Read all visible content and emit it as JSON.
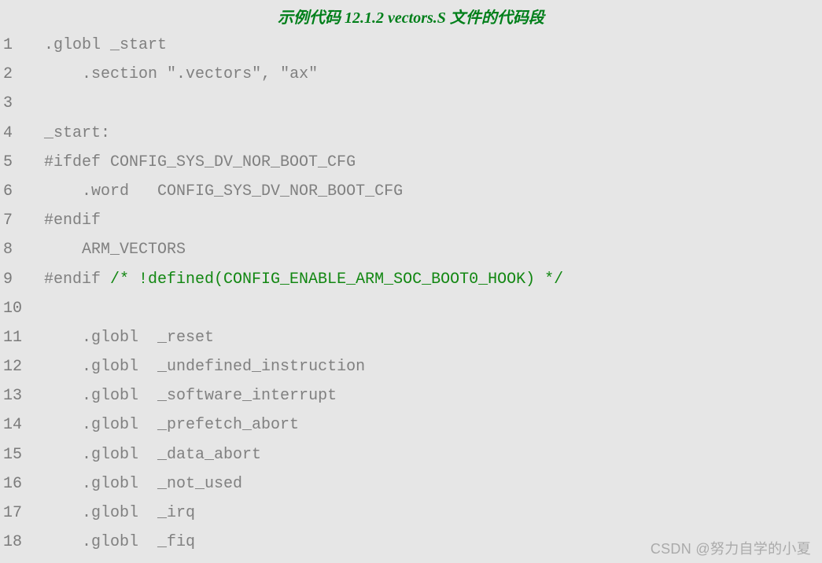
{
  "title": "示例代码 12.1.2 vectors.S 文件的代码段",
  "lines": [
    {
      "n": "1",
      "html": "<span class='directive'>.globl _start</span>"
    },
    {
      "n": "2",
      "html": "    <span class='directive'>.section </span><span class='string'>\".vectors\"</span><span class='directive'>, </span><span class='string'>\"ax\"</span>"
    },
    {
      "n": "3",
      "html": ""
    },
    {
      "n": "4",
      "html": "<span class='symbol'>_start:</span>"
    },
    {
      "n": "5",
      "html": "<span class='preproc'>#ifdef CONFIG_SYS_DV_NOR_BOOT_CFG</span>"
    },
    {
      "n": "6",
      "html": "    <span class='directive'>.word   CONFIG_SYS_DV_NOR_BOOT_CFG</span>"
    },
    {
      "n": "7",
      "html": "<span class='preproc'>#endif</span>"
    },
    {
      "n": "8",
      "html": "    <span class='symbol'>ARM_VECTORS</span>"
    },
    {
      "n": "9",
      "html": "<span class='preproc'>#endif </span><span class='comment'>/* !defined(CONFIG_ENABLE_ARM_SOC_BOOT0_HOOK) */</span>"
    },
    {
      "n": "10",
      "html": ""
    },
    {
      "n": "11",
      "html": "    <span class='directive'>.globl  _reset</span>"
    },
    {
      "n": "12",
      "html": "    <span class='directive'>.globl  _undefined_instruction</span>"
    },
    {
      "n": "13",
      "html": "    <span class='directive'>.globl  _software_interrupt</span>"
    },
    {
      "n": "14",
      "html": "    <span class='directive'>.globl  _prefetch_abort</span>"
    },
    {
      "n": "15",
      "html": "    <span class='directive'>.globl  _data_abort</span>"
    },
    {
      "n": "16",
      "html": "    <span class='directive'>.globl  _not_used</span>"
    },
    {
      "n": "17",
      "html": "    <span class='directive'>.globl  _irq</span>"
    },
    {
      "n": "18",
      "html": "    <span class='directive'>.globl  _fiq</span>"
    }
  ],
  "watermark": "CSDN @努力自学的小夏"
}
